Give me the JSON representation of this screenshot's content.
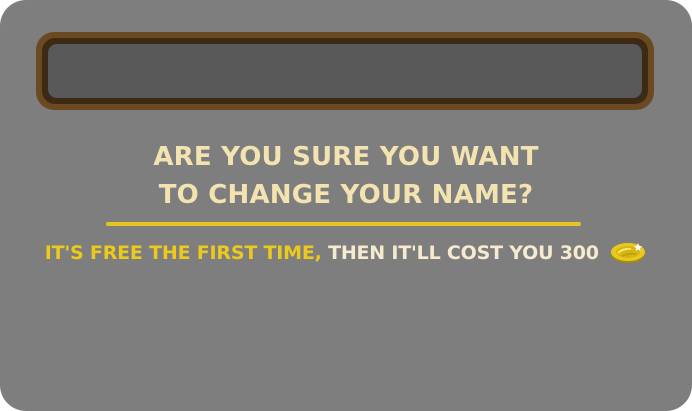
{
  "dialog": {
    "name_field": {
      "value": "",
      "placeholder": ""
    },
    "question_line1": "ARE YOU SURE YOU WANT",
    "question_line2": "TO CHANGE YOUR NAME?",
    "cost_free_text": "IT'S FREE THE FIRST TIME,",
    "cost_rest_text": "THEN IT'LL COST YOU 300",
    "currency_icon": "coin-icon"
  },
  "colors": {
    "panel": "#7e7e7e",
    "field_frame": "#6b4a22",
    "field": "#595959",
    "title_text": "#f3e3b0",
    "accent_yellow": "#ecc91d"
  }
}
